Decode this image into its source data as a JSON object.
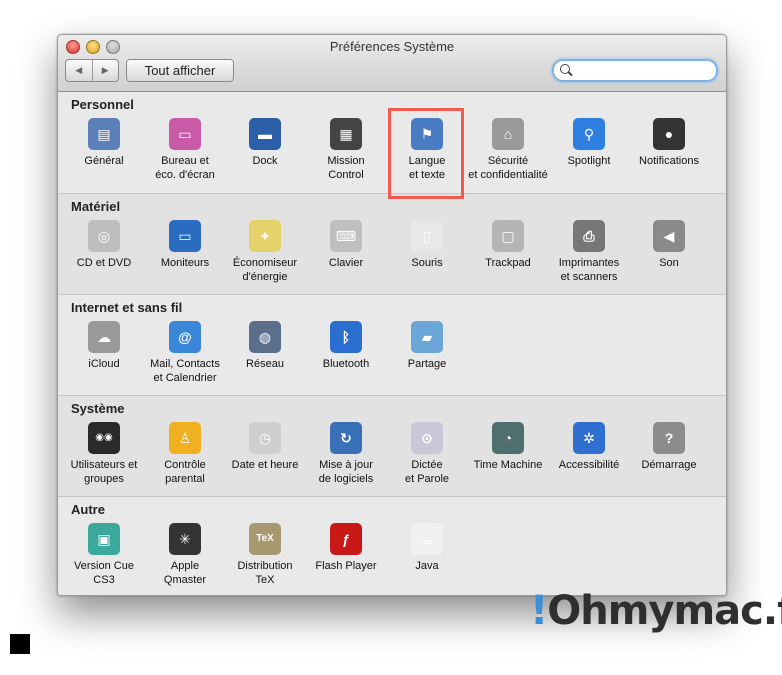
{
  "window": {
    "title": "Préférences Système"
  },
  "toolbar": {
    "back": "◀",
    "forward": "▶",
    "show_all": "Tout afficher",
    "search_value": ""
  },
  "sections": [
    {
      "title": "Personnel",
      "items": [
        {
          "label": "Général",
          "icon": "general-icon",
          "color": "#5b7fb8",
          "glyph": "▤"
        },
        {
          "label": "Bureau et\néco. d'écran",
          "icon": "desktop-icon",
          "color": "#c85aa8",
          "glyph": "▭"
        },
        {
          "label": "Dock",
          "icon": "dock-icon",
          "color": "#2d5fa8",
          "glyph": "▬"
        },
        {
          "label": "Mission\nControl",
          "icon": "mission-control-icon",
          "color": "#444444",
          "glyph": "▦"
        },
        {
          "label": "Langue\net texte",
          "icon": "flag-icon",
          "color": "#4a7cc4",
          "glyph": "⚑"
        },
        {
          "label": "Sécurité\net confidentialité",
          "icon": "house-lock-icon",
          "color": "#9a9a9a",
          "glyph": "⌂"
        },
        {
          "label": "Spotlight",
          "icon": "spotlight-icon",
          "color": "#2f7fe0",
          "glyph": "⚲"
        },
        {
          "label": "Notifications",
          "icon": "notifications-icon",
          "color": "#333333",
          "glyph": "●"
        }
      ]
    },
    {
      "title": "Matériel",
      "items": [
        {
          "label": "CD et DVD",
          "icon": "disc-icon",
          "color": "#bdbdbd",
          "glyph": "◎"
        },
        {
          "label": "Moniteurs",
          "icon": "monitor-icon",
          "color": "#2a6cc0",
          "glyph": "▭"
        },
        {
          "label": "Économiseur\nd'énergie",
          "icon": "bulb-icon",
          "color": "#e6d26a",
          "glyph": "✦"
        },
        {
          "label": "Clavier",
          "icon": "keyboard-icon",
          "color": "#bfbfbf",
          "glyph": "⌨"
        },
        {
          "label": "Souris",
          "icon": "mouse-icon",
          "color": "#e8e8e8",
          "glyph": "▯"
        },
        {
          "label": "Trackpad",
          "icon": "trackpad-icon",
          "color": "#b5b5b5",
          "glyph": "▢"
        },
        {
          "label": "Imprimantes\net scanners",
          "icon": "printer-icon",
          "color": "#777777",
          "glyph": "⎙"
        },
        {
          "label": "Son",
          "icon": "speaker-icon",
          "color": "#8a8a8a",
          "glyph": "◀"
        }
      ]
    },
    {
      "title": "Internet et sans fil",
      "items": [
        {
          "label": "iCloud",
          "icon": "icloud-icon",
          "color": "#9a9a9a",
          "glyph": "☁"
        },
        {
          "label": "Mail, Contacts\net Calendrier",
          "icon": "at-icon",
          "color": "#3a86d8",
          "glyph": "@"
        },
        {
          "label": "Réseau",
          "icon": "network-globe-icon",
          "color": "#5a6f8c",
          "glyph": "◍"
        },
        {
          "label": "Bluetooth",
          "icon": "bluetooth-icon",
          "color": "#2a6fd0",
          "glyph": "ᛒ"
        },
        {
          "label": "Partage",
          "icon": "sharing-folder-icon",
          "color": "#6aa6d8",
          "glyph": "▰"
        }
      ]
    },
    {
      "title": "Système",
      "items": [
        {
          "label": "Utilisateurs et\ngroupes",
          "icon": "users-icon",
          "color": "#2a2a2a",
          "glyph": "◉◉"
        },
        {
          "label": "Contrôle\nparental",
          "icon": "parental-icon",
          "color": "#f0b020",
          "glyph": "♙"
        },
        {
          "label": "Date et heure",
          "icon": "clock-calendar-icon",
          "color": "#cfcfcf",
          "glyph": "◷"
        },
        {
          "label": "Mise à jour\nde logiciels",
          "icon": "update-icon",
          "color": "#3a70b8",
          "glyph": "↻"
        },
        {
          "label": "Dictée\net Parole",
          "icon": "microphone-icon",
          "color": "#c8c8d8",
          "glyph": "⊙"
        },
        {
          "label": "Time Machine",
          "icon": "time-machine-icon",
          "color": "#4f6f6f",
          "glyph": "◔"
        },
        {
          "label": "Accessibilité",
          "icon": "accessibility-icon",
          "color": "#2f6fd0",
          "glyph": "✲"
        },
        {
          "label": "Démarrage",
          "icon": "startup-disk-icon",
          "color": "#8c8c8c",
          "glyph": "?"
        }
      ]
    },
    {
      "title": "Autre",
      "items": [
        {
          "label": "Version Cue\nCS3",
          "icon": "version-cue-icon",
          "color": "#3aa89a",
          "glyph": "▣"
        },
        {
          "label": "Apple\nQmaster",
          "icon": "qmaster-icon",
          "color": "#333333",
          "glyph": "✳"
        },
        {
          "label": "Distribution\nTeX",
          "icon": "tex-icon",
          "color": "#a89870",
          "glyph": "TeX"
        },
        {
          "label": "Flash Player",
          "icon": "flash-icon",
          "color": "#c81818",
          "glyph": "ƒ"
        },
        {
          "label": "Java",
          "icon": "java-icon",
          "color": "#f0f0f0",
          "glyph": "☕"
        }
      ]
    }
  ],
  "watermark": {
    "bang": "!",
    "text": "Ohmymac.fr"
  }
}
